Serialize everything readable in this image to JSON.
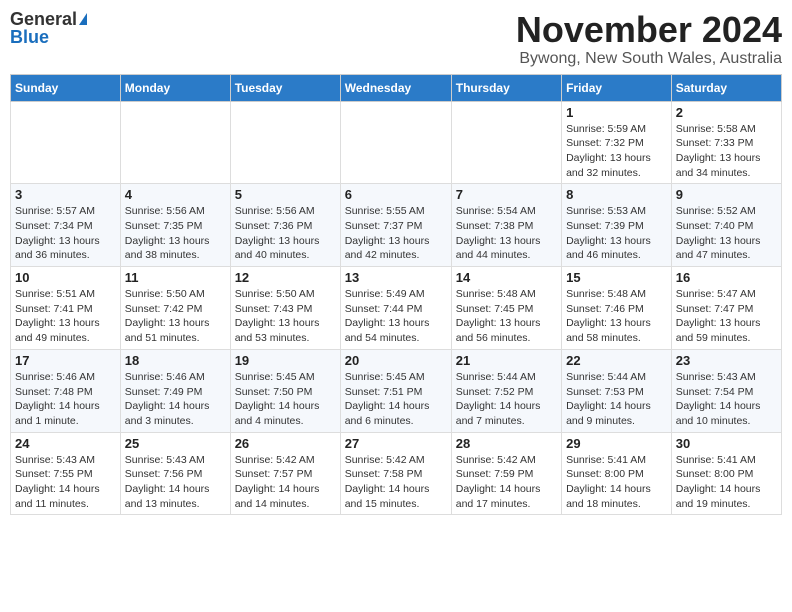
{
  "header": {
    "logo_general": "General",
    "logo_blue": "Blue",
    "title": "November 2024",
    "subtitle": "Bywong, New South Wales, Australia"
  },
  "weekdays": [
    "Sunday",
    "Monday",
    "Tuesday",
    "Wednesday",
    "Thursday",
    "Friday",
    "Saturday"
  ],
  "weeks": [
    [
      {
        "day": "",
        "detail": ""
      },
      {
        "day": "",
        "detail": ""
      },
      {
        "day": "",
        "detail": ""
      },
      {
        "day": "",
        "detail": ""
      },
      {
        "day": "",
        "detail": ""
      },
      {
        "day": "1",
        "detail": "Sunrise: 5:59 AM\nSunset: 7:32 PM\nDaylight: 13 hours and 32 minutes."
      },
      {
        "day": "2",
        "detail": "Sunrise: 5:58 AM\nSunset: 7:33 PM\nDaylight: 13 hours and 34 minutes."
      }
    ],
    [
      {
        "day": "3",
        "detail": "Sunrise: 5:57 AM\nSunset: 7:34 PM\nDaylight: 13 hours and 36 minutes."
      },
      {
        "day": "4",
        "detail": "Sunrise: 5:56 AM\nSunset: 7:35 PM\nDaylight: 13 hours and 38 minutes."
      },
      {
        "day": "5",
        "detail": "Sunrise: 5:56 AM\nSunset: 7:36 PM\nDaylight: 13 hours and 40 minutes."
      },
      {
        "day": "6",
        "detail": "Sunrise: 5:55 AM\nSunset: 7:37 PM\nDaylight: 13 hours and 42 minutes."
      },
      {
        "day": "7",
        "detail": "Sunrise: 5:54 AM\nSunset: 7:38 PM\nDaylight: 13 hours and 44 minutes."
      },
      {
        "day": "8",
        "detail": "Sunrise: 5:53 AM\nSunset: 7:39 PM\nDaylight: 13 hours and 46 minutes."
      },
      {
        "day": "9",
        "detail": "Sunrise: 5:52 AM\nSunset: 7:40 PM\nDaylight: 13 hours and 47 minutes."
      }
    ],
    [
      {
        "day": "10",
        "detail": "Sunrise: 5:51 AM\nSunset: 7:41 PM\nDaylight: 13 hours and 49 minutes."
      },
      {
        "day": "11",
        "detail": "Sunrise: 5:50 AM\nSunset: 7:42 PM\nDaylight: 13 hours and 51 minutes."
      },
      {
        "day": "12",
        "detail": "Sunrise: 5:50 AM\nSunset: 7:43 PM\nDaylight: 13 hours and 53 minutes."
      },
      {
        "day": "13",
        "detail": "Sunrise: 5:49 AM\nSunset: 7:44 PM\nDaylight: 13 hours and 54 minutes."
      },
      {
        "day": "14",
        "detail": "Sunrise: 5:48 AM\nSunset: 7:45 PM\nDaylight: 13 hours and 56 minutes."
      },
      {
        "day": "15",
        "detail": "Sunrise: 5:48 AM\nSunset: 7:46 PM\nDaylight: 13 hours and 58 minutes."
      },
      {
        "day": "16",
        "detail": "Sunrise: 5:47 AM\nSunset: 7:47 PM\nDaylight: 13 hours and 59 minutes."
      }
    ],
    [
      {
        "day": "17",
        "detail": "Sunrise: 5:46 AM\nSunset: 7:48 PM\nDaylight: 14 hours and 1 minute."
      },
      {
        "day": "18",
        "detail": "Sunrise: 5:46 AM\nSunset: 7:49 PM\nDaylight: 14 hours and 3 minutes."
      },
      {
        "day": "19",
        "detail": "Sunrise: 5:45 AM\nSunset: 7:50 PM\nDaylight: 14 hours and 4 minutes."
      },
      {
        "day": "20",
        "detail": "Sunrise: 5:45 AM\nSunset: 7:51 PM\nDaylight: 14 hours and 6 minutes."
      },
      {
        "day": "21",
        "detail": "Sunrise: 5:44 AM\nSunset: 7:52 PM\nDaylight: 14 hours and 7 minutes."
      },
      {
        "day": "22",
        "detail": "Sunrise: 5:44 AM\nSunset: 7:53 PM\nDaylight: 14 hours and 9 minutes."
      },
      {
        "day": "23",
        "detail": "Sunrise: 5:43 AM\nSunset: 7:54 PM\nDaylight: 14 hours and 10 minutes."
      }
    ],
    [
      {
        "day": "24",
        "detail": "Sunrise: 5:43 AM\nSunset: 7:55 PM\nDaylight: 14 hours and 11 minutes."
      },
      {
        "day": "25",
        "detail": "Sunrise: 5:43 AM\nSunset: 7:56 PM\nDaylight: 14 hours and 13 minutes."
      },
      {
        "day": "26",
        "detail": "Sunrise: 5:42 AM\nSunset: 7:57 PM\nDaylight: 14 hours and 14 minutes."
      },
      {
        "day": "27",
        "detail": "Sunrise: 5:42 AM\nSunset: 7:58 PM\nDaylight: 14 hours and 15 minutes."
      },
      {
        "day": "28",
        "detail": "Sunrise: 5:42 AM\nSunset: 7:59 PM\nDaylight: 14 hours and 17 minutes."
      },
      {
        "day": "29",
        "detail": "Sunrise: 5:41 AM\nSunset: 8:00 PM\nDaylight: 14 hours and 18 minutes."
      },
      {
        "day": "30",
        "detail": "Sunrise: 5:41 AM\nSunset: 8:00 PM\nDaylight: 14 hours and 19 minutes."
      }
    ]
  ]
}
